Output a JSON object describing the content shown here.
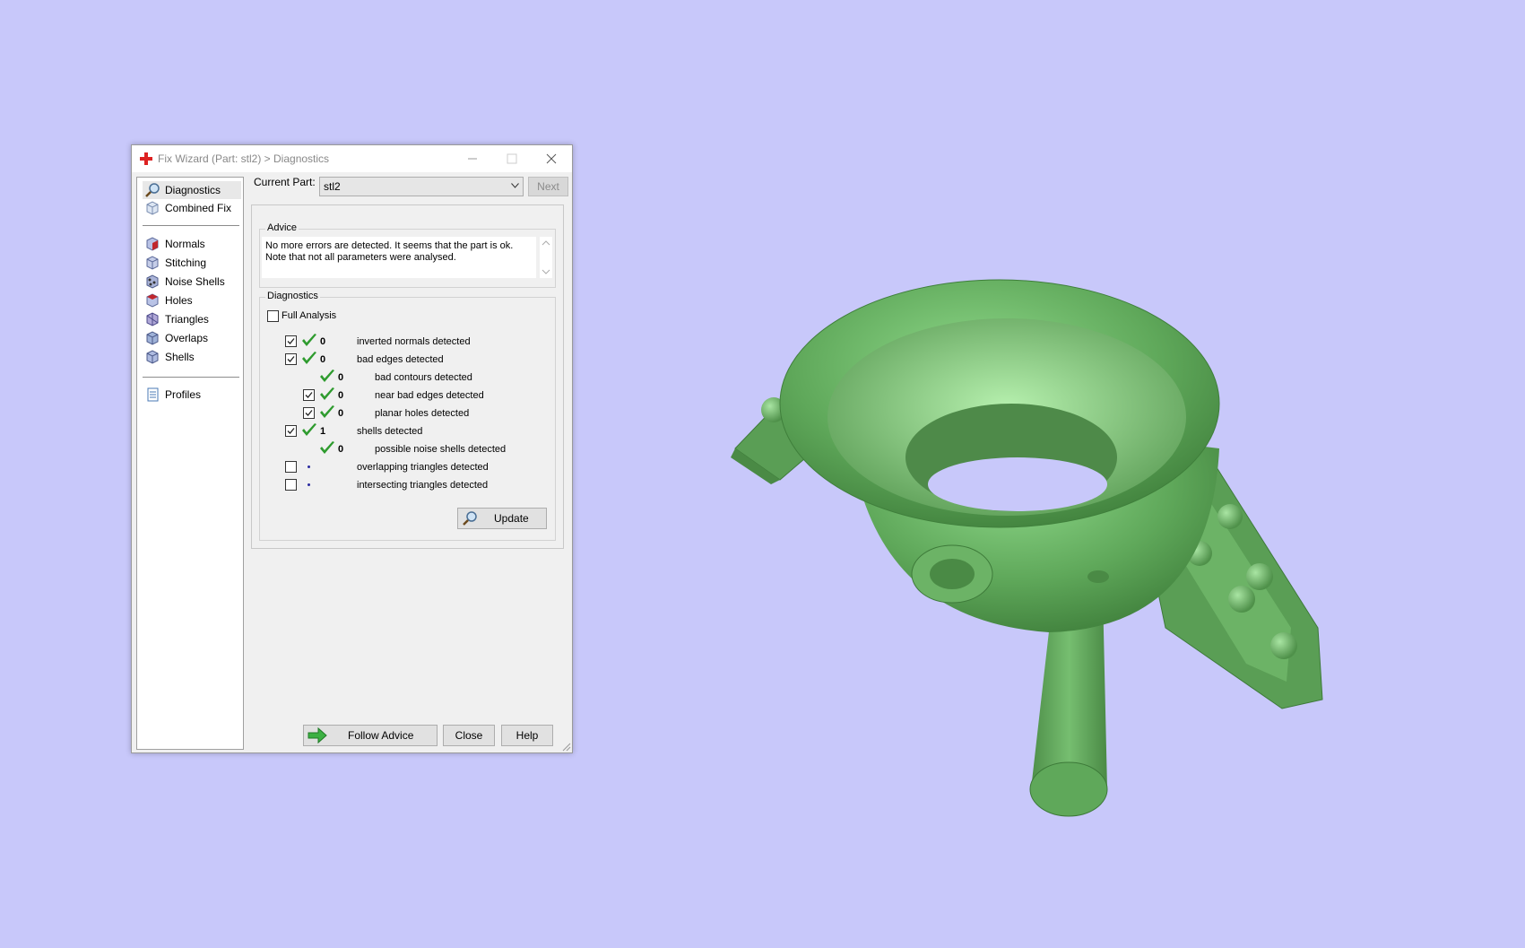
{
  "window": {
    "title": "Fix Wizard (Part: stl2) > Diagnostics"
  },
  "sidebar": {
    "items": [
      {
        "label": "Diagnostics",
        "icon": "magnifier-icon"
      },
      {
        "label": "Combined Fix",
        "icon": "cube-icon"
      },
      {
        "label": "Normals",
        "icon": "normals-cube-icon"
      },
      {
        "label": "Stitching",
        "icon": "stitching-cube-icon"
      },
      {
        "label": "Noise Shells",
        "icon": "noise-shells-icon"
      },
      {
        "label": "Holes",
        "icon": "holes-cube-icon"
      },
      {
        "label": "Triangles",
        "icon": "triangles-cube-icon"
      },
      {
        "label": "Overlaps",
        "icon": "overlaps-cube-icon"
      },
      {
        "label": "Shells",
        "icon": "shells-cube-icon"
      },
      {
        "label": "Profiles",
        "icon": "document-icon"
      }
    ],
    "selected": "Diagnostics"
  },
  "current_part": {
    "label": "Current Part:",
    "value": "stl2",
    "next_label": "Next"
  },
  "advice": {
    "title": "Advice",
    "line1": "No more errors are detected. It seems that the part is ok.",
    "line2": "Note that not all parameters were analysed."
  },
  "diagnostics": {
    "title": "Diagnostics",
    "full_analysis_label": "Full Analysis",
    "full_analysis_checked": false,
    "rows": [
      {
        "checked": true,
        "has_checkbox": true,
        "status": "ok",
        "count": "0",
        "label": "inverted normals detected",
        "indent": 0
      },
      {
        "checked": true,
        "has_checkbox": true,
        "status": "ok",
        "count": "0",
        "label": "bad edges detected",
        "indent": 0
      },
      {
        "checked": false,
        "has_checkbox": false,
        "status": "ok",
        "count": "0",
        "label": "bad contours detected",
        "indent": 1
      },
      {
        "checked": true,
        "has_checkbox": true,
        "status": "ok",
        "count": "0",
        "label": "near bad edges detected",
        "indent": 1
      },
      {
        "checked": true,
        "has_checkbox": true,
        "status": "ok",
        "count": "0",
        "label": "planar holes detected",
        "indent": 1
      },
      {
        "checked": true,
        "has_checkbox": true,
        "status": "ok",
        "count": "1",
        "label": "shells detected",
        "indent": 0
      },
      {
        "checked": false,
        "has_checkbox": false,
        "status": "ok",
        "count": "0",
        "label": "possible noise shells detected",
        "indent": 1
      },
      {
        "checked": false,
        "has_checkbox": true,
        "status": "none",
        "count": "",
        "label": "overlapping triangles detected",
        "indent": 0
      },
      {
        "checked": false,
        "has_checkbox": true,
        "status": "none",
        "count": "",
        "label": "intersecting triangles detected",
        "indent": 0
      }
    ],
    "update_label": "Update"
  },
  "footer": {
    "follow_advice_label": "Follow Advice",
    "close_label": "Close",
    "help_label": "Help"
  },
  "colors": {
    "background": "#c8c8fa",
    "model_green": "#5fa85a",
    "check_green": "#2e9b2e"
  }
}
